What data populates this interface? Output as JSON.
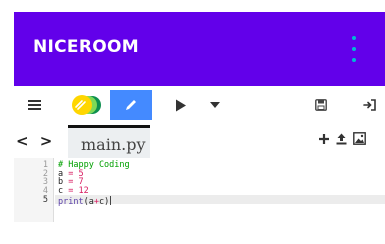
{
  "header": {
    "brand": "NICEROOM",
    "menu_icon": "kebab-menu-icon",
    "background": "#6200ea",
    "accent": "#00b8d4"
  },
  "toolbar": {
    "menu_icon": "hamburger-icon",
    "theme_icon": "theme-toggle-icon",
    "edit_icon": "pencil-icon",
    "run_icon": "play-icon",
    "dropdown_icon": "caret-down-icon",
    "save_icon": "save-icon",
    "signin_icon": "sign-in-icon",
    "active_color": "#448aff"
  },
  "tabs": {
    "nav": "< >",
    "items": [
      {
        "label": "main.py",
        "active": true
      }
    ],
    "actions": [
      "add-file-icon",
      "upload-icon",
      "image-icon"
    ]
  },
  "editor": {
    "line_numbers": [
      "1",
      "2",
      "3",
      "4",
      "5"
    ],
    "lines": [
      [
        {
          "t": "# Happy Coding",
          "k": "comment"
        }
      ],
      [
        {
          "t": "a ",
          "k": "plain"
        },
        {
          "t": "=",
          "k": "op"
        },
        {
          "t": " 5",
          "k": "num"
        }
      ],
      [
        {
          "t": "b ",
          "k": "plain"
        },
        {
          "t": "=",
          "k": "op"
        },
        {
          "t": " 7",
          "k": "num"
        }
      ],
      [
        {
          "t": "c ",
          "k": "plain"
        },
        {
          "t": "=",
          "k": "op"
        },
        {
          "t": " 12",
          "k": "num"
        }
      ],
      [
        {
          "t": "print",
          "k": "kw"
        },
        {
          "t": "(a",
          "k": "plain"
        },
        {
          "t": "+",
          "k": "op"
        },
        {
          "t": "c)",
          "k": "plain"
        }
      ]
    ],
    "active_line": 5
  }
}
